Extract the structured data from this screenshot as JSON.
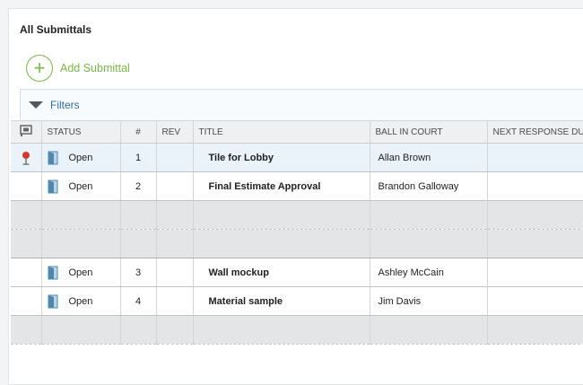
{
  "page": {
    "title": "All Submittals"
  },
  "toolbar": {
    "add_label": "Add Submittal",
    "add_icon": "plus-circle-icon"
  },
  "filters": {
    "label": "Filters",
    "icon": "triangle-down-icon"
  },
  "table": {
    "columns": {
      "icon": "flag-icon",
      "status": "STATUS",
      "number": "#",
      "rev": "REV",
      "title": "TITLE",
      "ball_in_court": "BALL IN COURT",
      "next_response": "NEXT RESPONSE DUE"
    },
    "rows": [
      {
        "pinned": true,
        "status": "Open",
        "number": "1",
        "rev": "",
        "title": "Tile for Lobby",
        "ball_in_court": "Allan Brown",
        "next_response": ""
      },
      {
        "pinned": false,
        "status": "Open",
        "number": "2",
        "rev": "",
        "title": "Final Estimate Approval",
        "ball_in_court": "Brandon Galloway",
        "next_response": ""
      },
      {
        "pinned": false,
        "status": "Open",
        "number": "3",
        "rev": "",
        "title": "Wall mockup",
        "ball_in_court": "Ashley McCain",
        "next_response": ""
      },
      {
        "pinned": false,
        "status": "Open",
        "number": "4",
        "rev": "",
        "title": "Material sample",
        "ball_in_court": "Jim Davis",
        "next_response": ""
      }
    ]
  },
  "colors": {
    "accent_green": "#7ab648",
    "link_blue": "#2e6f9e",
    "selected_row": "#eaf3fa"
  }
}
